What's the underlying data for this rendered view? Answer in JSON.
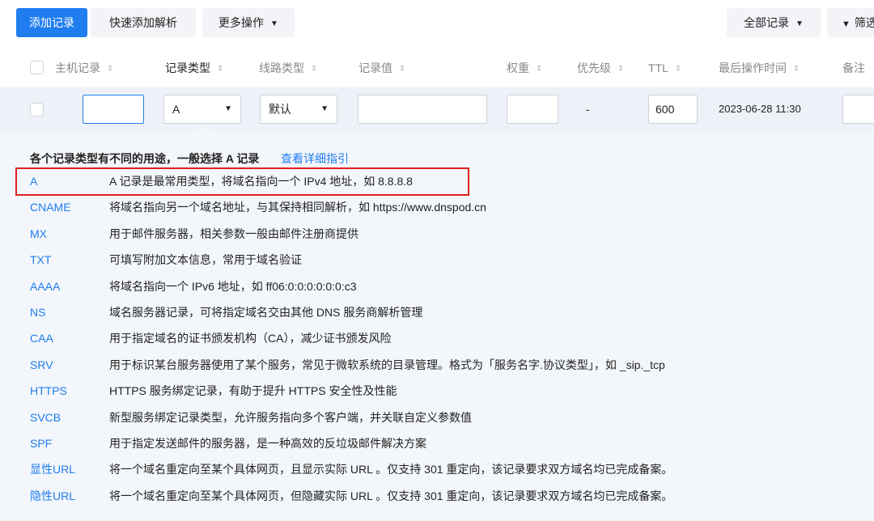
{
  "toolbar": {
    "add_record": "添加记录",
    "quick_add": "快速添加解析",
    "more_actions": "更多操作",
    "all_records": "全部记录",
    "filter": "筛选"
  },
  "header": {
    "host": "主机记录",
    "type": "记录类型",
    "line": "线路类型",
    "value": "记录值",
    "weight": "权重",
    "priority": "优先级",
    "ttl": "TTL",
    "last_op": "最后操作时间",
    "note": "备注"
  },
  "editrow": {
    "host_value": "",
    "type_value": "A",
    "line_value": "默认",
    "record_value": "",
    "weight_value": "",
    "priority_value": "-",
    "ttl_value": "600",
    "last_op_value": "2023-06-28 11:30"
  },
  "panel": {
    "title": "各个记录类型有不同的用途，一般选择 A 记录",
    "guide_link": "查看详细指引",
    "types": [
      {
        "name": "A",
        "desc": "A 记录是最常用类型，将域名指向一个 IPv4 地址，如 8.8.8.8"
      },
      {
        "name": "CNAME",
        "desc": "将域名指向另一个域名地址，与其保持相同解析，如 https://www.dnspod.cn"
      },
      {
        "name": "MX",
        "desc": "用于邮件服务器，相关参数一般由邮件注册商提供"
      },
      {
        "name": "TXT",
        "desc": "可填写附加文本信息，常用于域名验证"
      },
      {
        "name": "AAAA",
        "desc": "将域名指向一个 IPv6 地址，如 ff06:0:0:0:0:0:0:c3"
      },
      {
        "name": "NS",
        "desc": "域名服务器记录，可将指定域名交由其他 DNS 服务商解析管理"
      },
      {
        "name": "CAA",
        "desc": "用于指定域名的证书颁发机构（CA），减少证书颁发风险"
      },
      {
        "name": "SRV",
        "desc": "用于标识某台服务器使用了某个服务，常见于微软系统的目录管理。格式为「服务名字.协议类型」，如 _sip._tcp"
      },
      {
        "name": "HTTPS",
        "desc": "HTTPS 服务绑定记录，有助于提升 HTTPS 安全性及性能"
      },
      {
        "name": "SVCB",
        "desc": "新型服务绑定记录类型，允许服务指向多个客户端，并关联自定义参数值"
      },
      {
        "name": "SPF",
        "desc": "用于指定发送邮件的服务器，是一种高效的反垃圾邮件解决方案"
      },
      {
        "name": "显性URL",
        "desc": "将一个域名重定向至某个具体网页，且显示实际 URL 。仅支持 301 重定向，该记录要求双方域名均已完成备案。"
      },
      {
        "name": "隐性URL",
        "desc": "将一个域名重定向至某个具体网页，但隐藏实际 URL 。仅支持 301 重定向，该记录要求双方域名均已完成备案。"
      }
    ]
  },
  "colors": {
    "accent": "#1f7df0",
    "highlight": "#e02020",
    "panel_bg": "#f3f6fa"
  }
}
